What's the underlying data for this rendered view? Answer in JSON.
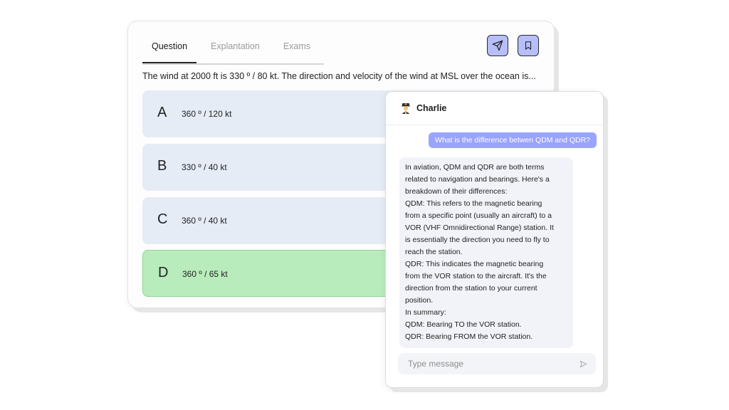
{
  "tabs": [
    {
      "label": "Question",
      "active": true
    },
    {
      "label": "Explantation",
      "active": false
    },
    {
      "label": "Exams",
      "active": false
    }
  ],
  "actions": {
    "send_icon": "paper-plane-icon",
    "bookmark_icon": "bookmark-icon"
  },
  "question": {
    "text": "The wind at 2000 ft is 330 º / 80 kt. The direction and velocity of the wind at MSL over the ocean is..."
  },
  "options": [
    {
      "letter": "A",
      "text": "360 º / 120 kt",
      "correct": false
    },
    {
      "letter": "B",
      "text": "330 º / 40 kt",
      "correct": false
    },
    {
      "letter": "C",
      "text": "360 º / 40 kt",
      "correct": false
    },
    {
      "letter": "D",
      "text": "360 º / 65 kt",
      "correct": true
    }
  ],
  "chat": {
    "name": "Charlie",
    "avatar_icon": "pilot-avatar-icon",
    "user_message": "What is the difference betwen QDM and QDR?",
    "bot_lines": [
      "In aviation, QDM and QDR are both terms",
      "related to navigation and bearings. Here's a",
      "breakdown of their differences:",
      "QDM: This refers to the magnetic bearing",
      "from a specific point (usually an aircraft) to a",
      "VOR (VHF Omnidirectional Range) station. It",
      "is essentially the direction you need to fly to",
      "reach the station.",
      "QDR: This indicates the magnetic bearing",
      "from the VOR station to the aircraft. It's the",
      "direction from the station to your current",
      "position.",
      "In summary:",
      "QDM: Bearing TO the VOR station.",
      "QDR: Bearing FROM the VOR station."
    ],
    "input_placeholder": "Type message"
  },
  "colors": {
    "accent": "#b6bffb",
    "user_bubble": "#9aa4fb",
    "option_bg": "#e6ecf6",
    "correct_bg": "#b9ecbc"
  }
}
